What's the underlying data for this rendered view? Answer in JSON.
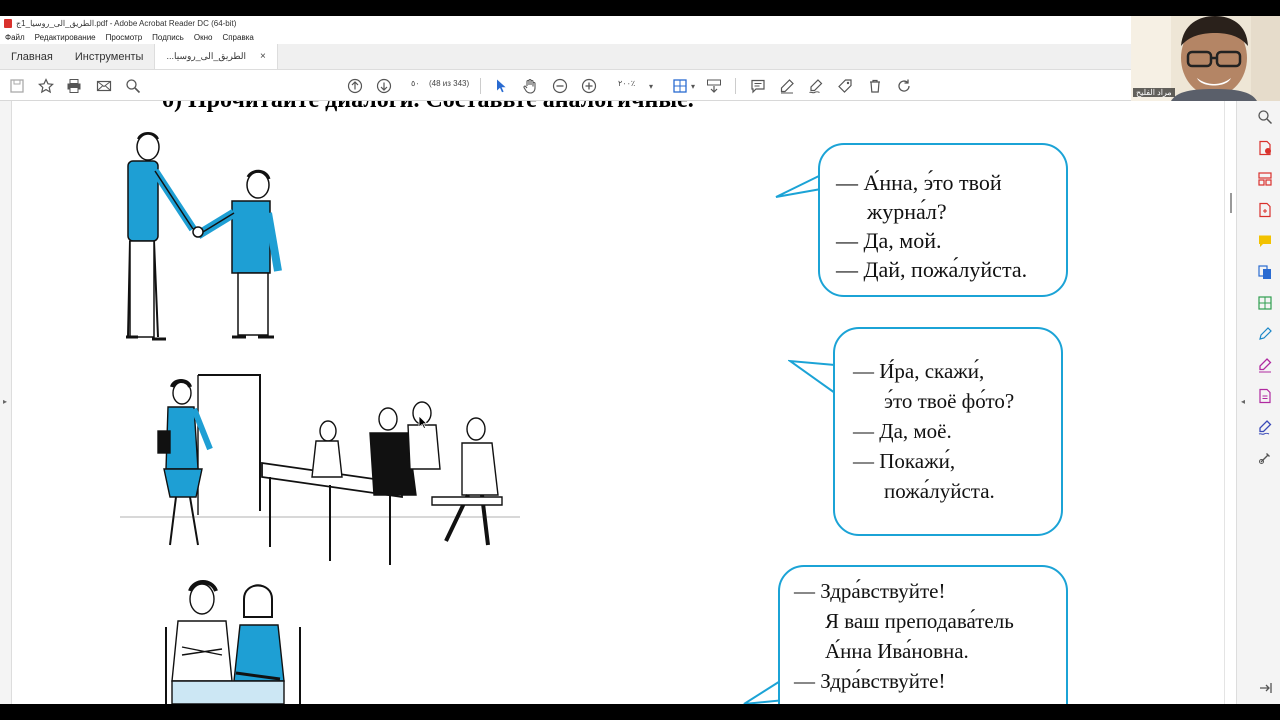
{
  "window": {
    "title": "الطريق_الى_روسيا_1ج.pdf - Adobe Acrobat Reader DC (64-bit)"
  },
  "menu": {
    "items": [
      "Файл",
      "Редактирование",
      "Просмотр",
      "Подпись",
      "Окно",
      "Справка"
    ]
  },
  "tabs": {
    "home": "Главная",
    "tools": "Инструменты",
    "document": "...الطريق_الى_روسيا",
    "close": "×"
  },
  "toolbar": {
    "page_number": "٥٠",
    "page_count": "(48 из 343)",
    "zoom": "٢٠٠٪"
  },
  "webcam": {
    "name": "مراد الفليح"
  },
  "document": {
    "heading": "б) Прочитайте диалоги. Составьте аналогичные.",
    "dialog1": {
      "lines": [
        "— А́нна, э́то твой",
        "журна́л?",
        "— Да, мой.",
        "— Дай, пожа́луйста."
      ]
    },
    "dialog2": {
      "lines": [
        "— И́ра, скажи́,",
        "э́то твоё фо́то?",
        "— Да, моё.",
        "— Покажи́,",
        "пожа́луйста."
      ]
    },
    "dialog3": {
      "lines": [
        "— Здра́вствуйте!",
        "Я ваш преподава́тель",
        "А́нна Ива́новна.",
        "— Здра́вствуйте!"
      ]
    }
  },
  "colors": {
    "bubble_border": "#1ba3d6",
    "figure_blue": "#1e9fd4",
    "toolbar_blue": "#2a6bd1"
  }
}
